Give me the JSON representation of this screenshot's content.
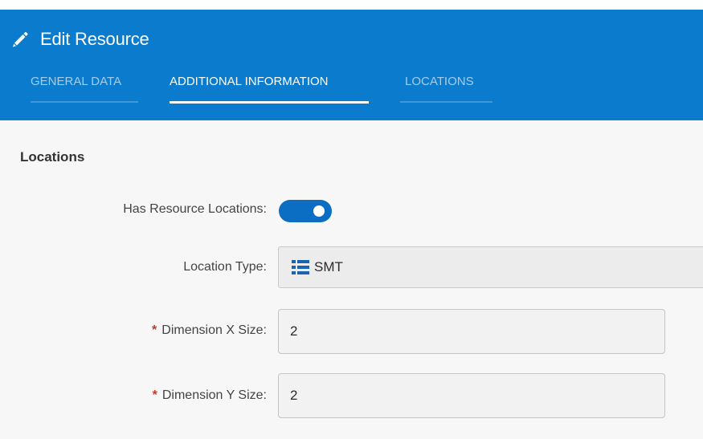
{
  "header": {
    "title": "Edit Resource",
    "icon": "pencil-icon",
    "background_color": "#0b7bce"
  },
  "tabs": [
    {
      "label": "GENERAL DATA",
      "active": false
    },
    {
      "label": "ADDITIONAL INFORMATION",
      "active": true
    },
    {
      "label": "LOCATIONS",
      "active": false
    }
  ],
  "section": {
    "title": "Locations"
  },
  "form": {
    "has_locations": {
      "label": "Has Resource Locations:",
      "value": true
    },
    "location_type": {
      "label": "Location Type:",
      "value": "SMT",
      "icon": "list-icon"
    },
    "dim_x": {
      "label": "Dimension X Size:",
      "value": "2",
      "required": true
    },
    "dim_y": {
      "label": "Dimension Y Size:",
      "value": "2",
      "required": true
    }
  }
}
